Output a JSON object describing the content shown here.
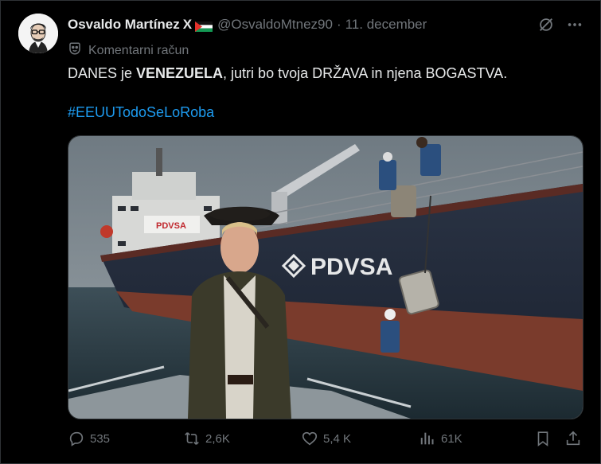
{
  "tweet": {
    "author_name": "Osvaldo Martínez",
    "author_badge": "X",
    "handle": "@OsvaldoMtnez90",
    "separator": "·",
    "date": "11. december",
    "account_label": "Komentarni račun",
    "text_part1": "DANES je ",
    "text_bold": "VENEZUELA",
    "text_part2": ", jutri bo tvoja DRŽAVA in njena BOGASTVA.",
    "hashtag": "#EEUUTodoSeLoRoba",
    "image_ship_label": "PDVSA",
    "image_ship_label_small": "PDVSA"
  },
  "metrics": {
    "replies": "535",
    "reposts": "2,6K",
    "likes": "5,4 K",
    "views": "61K"
  },
  "colors": {
    "background": "#000000",
    "text": "#e7e9ea",
    "muted": "#71767b",
    "link": "#1d9bf0",
    "border": "#2f3336"
  },
  "icons": [
    "grok-icon",
    "more-icon",
    "comment-account-icon",
    "reply-icon",
    "repost-icon",
    "like-icon",
    "views-icon",
    "bookmark-icon",
    "share-icon"
  ]
}
